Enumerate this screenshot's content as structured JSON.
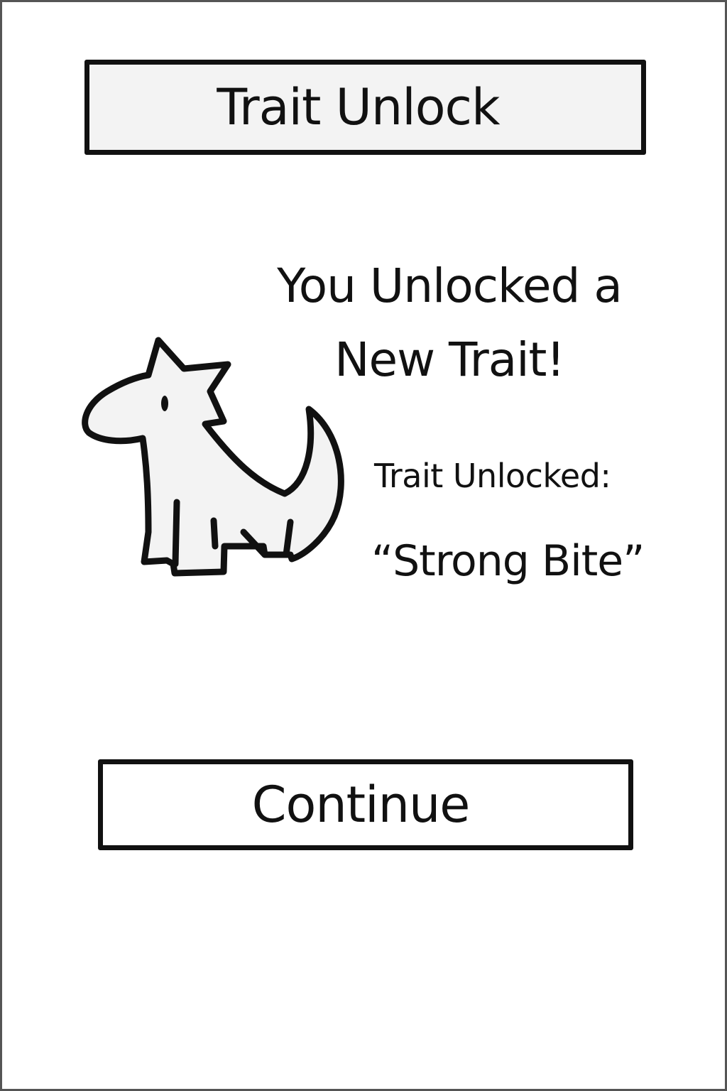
{
  "header": {
    "title": "Trait Unlock"
  },
  "main": {
    "headline": "You Unlocked a New Trait!",
    "trait_label": "Trait Unlocked:",
    "trait_name": "“Strong Bite”",
    "creature_icon": "dinosaur-creature-icon"
  },
  "actions": {
    "continue_label": "Continue"
  },
  "colors": {
    "ink": "#111111",
    "panel": "#f3f3f3",
    "background": "#ffffff",
    "frame": "#555555"
  }
}
